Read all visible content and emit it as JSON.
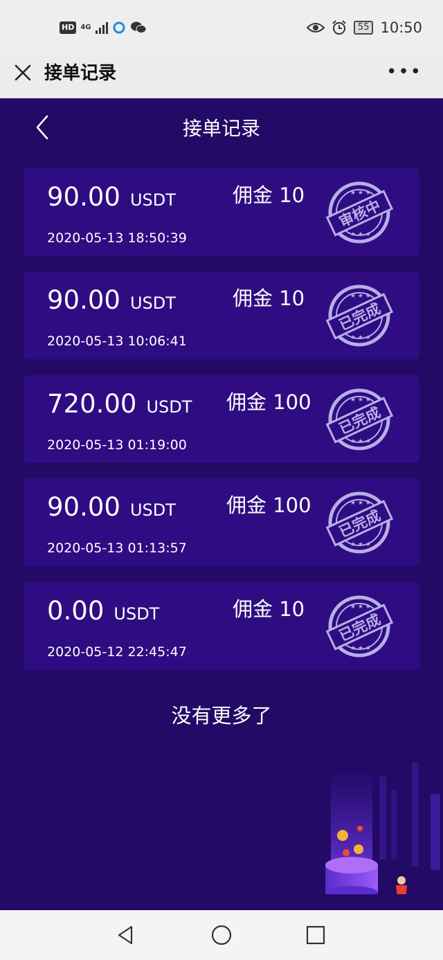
{
  "status": {
    "hd": "HD",
    "network": "4G",
    "battery": "55",
    "time": "10:50"
  },
  "header": {
    "title": "接单记录"
  },
  "page": {
    "title": "接单记录",
    "commission_label": "佣金",
    "no_more": "没有更多了"
  },
  "records": [
    {
      "amount": "90.00",
      "unit": "USDT",
      "commission": "10",
      "date": "2020-05-13 18:50:39",
      "status": "审核中"
    },
    {
      "amount": "90.00",
      "unit": "USDT",
      "commission": "10",
      "date": "2020-05-13 10:06:41",
      "status": "已完成"
    },
    {
      "amount": "720.00",
      "unit": "USDT",
      "commission": "100",
      "date": "2020-05-13 01:19:00",
      "status": "已完成"
    },
    {
      "amount": "90.00",
      "unit": "USDT",
      "commission": "100",
      "date": "2020-05-13 01:13:57",
      "status": "已完成"
    },
    {
      "amount": "0.00",
      "unit": "USDT",
      "commission": "10",
      "date": "2020-05-12 22:45:47",
      "status": "已完成"
    }
  ],
  "colors": {
    "background": "#230a66",
    "card": "#2f0c82",
    "stamp": "#b8aee6"
  },
  "icons": {
    "close": "close-icon",
    "more": "more-icon",
    "back": "chevron-left-icon",
    "nav_back": "triangle-back-icon",
    "nav_home": "circle-home-icon",
    "nav_recent": "square-recent-icon"
  }
}
